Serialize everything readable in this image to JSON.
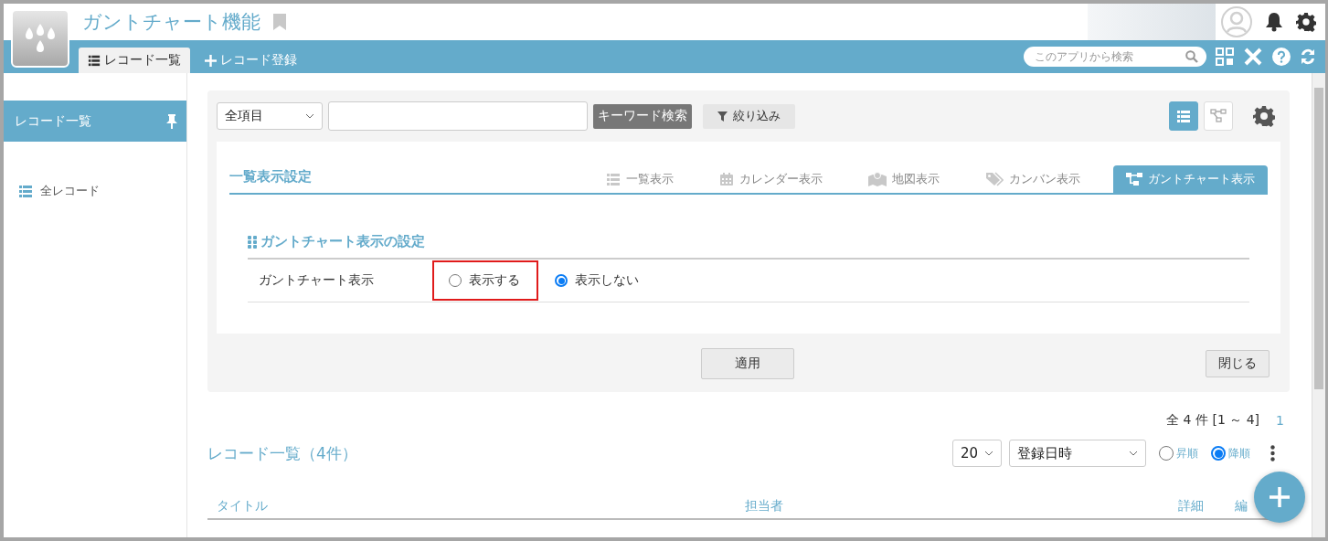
{
  "app": {
    "title": "ガントチャート機能"
  },
  "tabs": [
    {
      "label": "レコード一覧",
      "selected": true,
      "kind": "list"
    },
    {
      "label": "レコード登録",
      "selected": false,
      "kind": "add"
    }
  ],
  "search": {
    "placeholder": "このアプリから検索"
  },
  "sidebar": {
    "title": "レコード一覧",
    "items": [
      {
        "label": "全レコード"
      }
    ]
  },
  "toolbar": {
    "field_select": "全項目",
    "keyword_button": "キーワード検索",
    "filter_button": "絞り込み",
    "view_modes": [
      {
        "kind": "list",
        "selected": true
      },
      {
        "kind": "tree",
        "selected": false
      }
    ]
  },
  "settings": {
    "title": "一覧表示設定",
    "tabs": [
      {
        "label": "一覧表示",
        "kind": "list",
        "selected": false
      },
      {
        "label": "カレンダー表示",
        "kind": "calendar",
        "selected": false
      },
      {
        "label": "地図表示",
        "kind": "map",
        "selected": false
      },
      {
        "label": "カンバン表示",
        "kind": "tag",
        "selected": false
      },
      {
        "label": "ガントチャート表示",
        "kind": "gantt",
        "selected": true
      }
    ],
    "section_title": "ガントチャート表示の設定",
    "row_label": "ガントチャート表示",
    "options": [
      {
        "label": "表示する",
        "selected": false,
        "highlighted": true
      },
      {
        "label": "表示しない",
        "selected": true,
        "highlighted": false
      }
    ],
    "apply_button": "適用",
    "close_button": "閉じる"
  },
  "list": {
    "count": "全 4 件 [1 ～ 4]",
    "page": "1",
    "title": "レコード一覧（4件）",
    "per_page": "20",
    "sort_field": "登録日時",
    "order": [
      {
        "label": "昇順",
        "selected": false
      },
      {
        "label": "降順",
        "selected": true
      }
    ],
    "columns": [
      "タイトル",
      "担当者",
      "詳細",
      "編"
    ]
  }
}
